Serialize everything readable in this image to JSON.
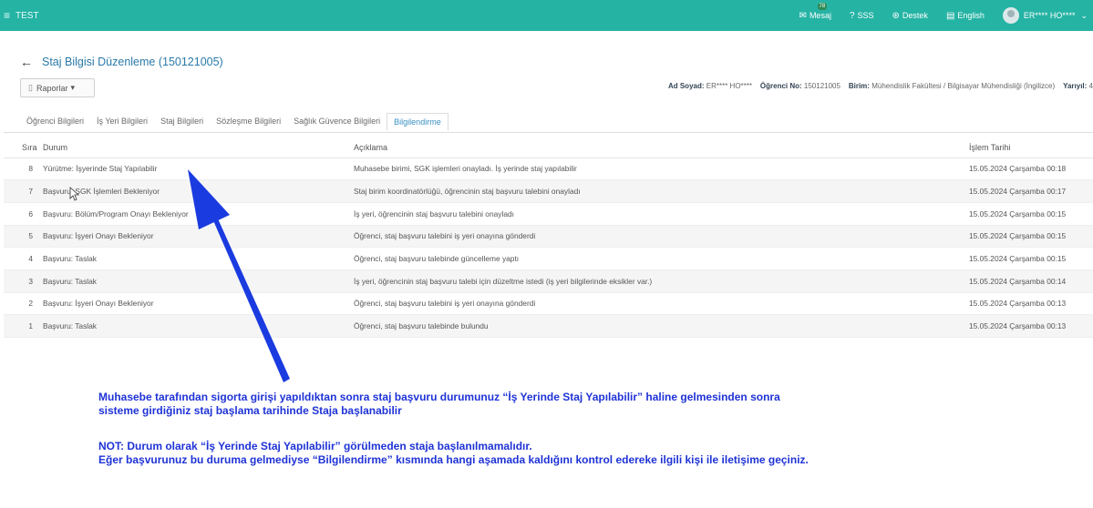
{
  "topbar": {
    "app_name": "TEST",
    "message_label": "Mesaj",
    "message_badge": "78",
    "faq_label": "SSS",
    "support_label": "Destek",
    "language_label": "English",
    "user_name": "ER**** HO****",
    "accent_color": "#25b3a4"
  },
  "header": {
    "title": "Staj Bilgisi Düzenleme (150121005)",
    "reports_label": "Raporlar",
    "info": {
      "name_label": "Ad Soyad:",
      "name_value": "ER**** HO****",
      "student_no_label": "Öğrenci No:",
      "student_no_value": "150121005",
      "unit_label": "Birim:",
      "unit_value": "Mühendislik Fakültesi / Bilgisayar Mühendisliği (İngilizce)",
      "semester_label": "Yarıyıl:",
      "semester_value": "4"
    }
  },
  "tabs": [
    "Öğrenci Bilgileri",
    "İş Yeri Bilgileri",
    "Staj Bilgileri",
    "Sözleşme Bilgileri",
    "Sağlık Güvence Bilgileri",
    "Bilgilendirme"
  ],
  "active_tab": "Bilgilendirme",
  "table": {
    "headers": {
      "sira": "Sıra",
      "durum": "Durum",
      "aciklama": "Açıklama",
      "tarih": "İşlem Tarihi"
    },
    "rows": [
      {
        "sira": "8",
        "durum": "Yürütme: İşyerinde Staj Yapılabilir",
        "aciklama": "Muhasebe birimi, SGK işlemleri onayladı. İş yerinde staj yapılabilir",
        "tarih": "15.05.2024 Çarşamba 00:18"
      },
      {
        "sira": "7",
        "durum": "Başvuru: SGK İşlemleri Bekleniyor",
        "aciklama": "Staj birim koordinatörlüğü, öğrencinin staj başvuru talebini onayladı",
        "tarih": "15.05.2024 Çarşamba 00:17"
      },
      {
        "sira": "6",
        "durum": "Başvuru: Bölüm/Program Onayı Bekleniyor",
        "aciklama": "İş yeri, öğrencinin staj başvuru talebini onayladı",
        "tarih": "15.05.2024 Çarşamba 00:15"
      },
      {
        "sira": "5",
        "durum": "Başvuru: İşyeri Onayı Bekleniyor",
        "aciklama": "Öğrenci, staj başvuru talebini iş yeri onayına gönderdi",
        "tarih": "15.05.2024 Çarşamba 00:15"
      },
      {
        "sira": "4",
        "durum": "Başvuru: Taslak",
        "aciklama": "Öğrenci, staj başvuru talebinde güncelleme yaptı",
        "tarih": "15.05.2024 Çarşamba 00:15"
      },
      {
        "sira": "3",
        "durum": "Başvuru: Taslak",
        "aciklama": "İş yeri, öğrencinin staj başvuru talebi için düzeltme istedi (iş yeri bilgilerinde eksikler var.)",
        "tarih": "15.05.2024 Çarşamba 00:14"
      },
      {
        "sira": "2",
        "durum": "Başvuru: İşyeri Onayı Bekleniyor",
        "aciklama": "Öğrenci, staj başvuru talebini iş yeri onayına gönderdi",
        "tarih": "15.05.2024 Çarşamba 00:13"
      },
      {
        "sira": "1",
        "durum": "Başvuru: Taslak",
        "aciklama": "Öğrenci, staj başvuru talebinde bulundu",
        "tarih": "15.05.2024 Çarşamba 00:13"
      }
    ]
  },
  "annotation": {
    "color": "#1f33d6",
    "line1": "Muhasebe tarafından sigorta girişi yapıldıktan sonra staj başvuru durumunuz “İş Yerinde Staj Yapılabilir” haline gelmesinden sonra",
    "line2": "sisteme girdiğiniz staj başlama tarihinde Staja başlanabilir",
    "line3": "NOT: Durum olarak “İş Yerinde Staj Yapılabilir” görülmeden staja başlanılmamalıdır.",
    "line4": "Eğer başvurunuz bu duruma gelmediyse  “Bilgilendirme” kısmında hangi aşamada kaldığını kontrol edereke ilgili kişi ile iletişime geçiniz."
  }
}
